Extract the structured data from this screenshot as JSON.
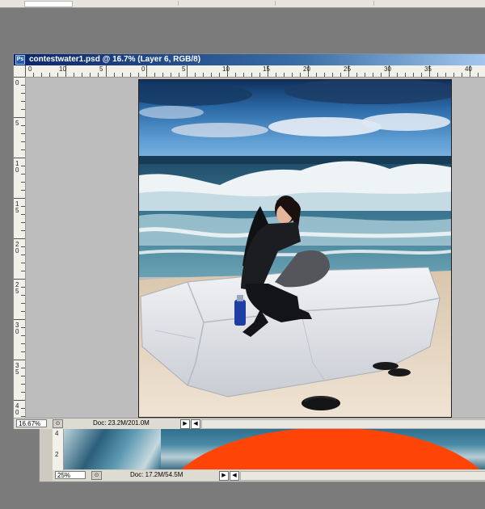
{
  "background_window": {
    "zoom": "25%",
    "doc_info": "Doc: 17.2M/54.5M",
    "ruler_labels": [
      "2",
      "4"
    ]
  },
  "document_window": {
    "title": "contestwater1.psd @ 16.7% (Layer 6, RGB/8)",
    "zoom": "16.67%",
    "doc_info": "Doc: 23.2M/201.0M",
    "horizontal_ruler_labels": [
      "0",
      "10",
      "5",
      "0",
      "5",
      "10",
      "15",
      "20",
      "25",
      "30",
      "35",
      "40"
    ],
    "vertical_ruler_labels": [
      "0",
      "5",
      "1\n0",
      "1\n5",
      "2\n0",
      "2\n5",
      "3\n0",
      "3\n5",
      "4\n0"
    ],
    "nav_arrow_glyph": "▶",
    "back_arrow_glyph": "◀",
    "info_glyph": "⊙"
  },
  "colors": {
    "title_bar_start": "#0a246a",
    "title_bar_end": "#a6caf0",
    "orange_layer": "#ff4408",
    "workspace_gray": "#7b7b7b",
    "sky": "#3d84bf",
    "rock": "#e3e5ea"
  },
  "icons": [
    "photoshop-document-icon",
    "info-icon",
    "play-arrow-icon",
    "left-arrow-icon"
  ]
}
